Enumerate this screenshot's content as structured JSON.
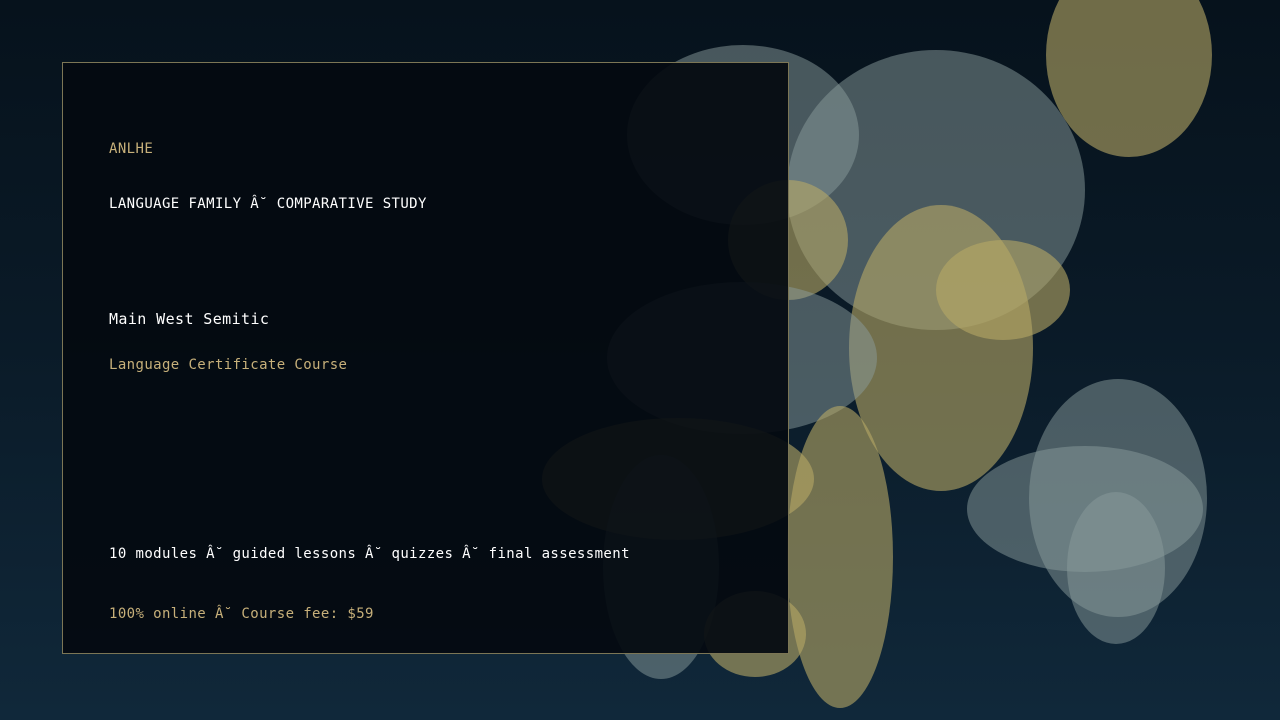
{
  "brand": "ANLHE",
  "kicker": "LANGUAGE FAMILY Â˘ COMPARATIVE STUDY",
  "title": "Main West Semitic",
  "subtitle": "Language Certificate Course",
  "details": "10 modules Â˘ guided lessons Â˘ quizzes Â˘ final assessment",
  "fee_line": "100% online Â˘ Course fee: $59",
  "colors": {
    "accent_gold": "#c7b07a",
    "bubble_gold": "#b8a865",
    "bubble_gray": "#8a9c9c",
    "panel_border": "#7c7655",
    "text_white": "#ffffff"
  }
}
